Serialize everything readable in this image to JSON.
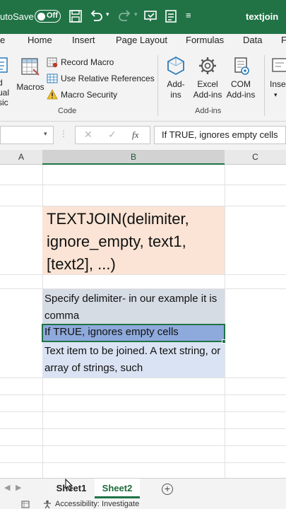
{
  "titlebar": {
    "autosave_label": "utoSave",
    "toggle_state": "Off",
    "file_title": "textjoin"
  },
  "tabs": [
    "e",
    "Home",
    "Insert",
    "Page Layout",
    "Formulas",
    "Data",
    "F"
  ],
  "ribbon": {
    "left_partial_lines": [
      "d",
      "ual",
      "sic"
    ],
    "macros_label": "Macros",
    "code_items": [
      "Record Macro",
      "Use Relative References",
      "Macro Security"
    ],
    "code_group": "Code",
    "addins": [
      {
        "line1": "Add-",
        "line2": "ins"
      },
      {
        "line1": "Excel",
        "line2": "Add-ins"
      },
      {
        "line1": "COM",
        "line2": "Add-ins"
      }
    ],
    "addins_group": "Add-ins",
    "insert_partial": "Inse"
  },
  "formula_bar": {
    "fx": "fx",
    "value": "If TRUE, ignores empty cells"
  },
  "columns": [
    "A",
    "B",
    "C"
  ],
  "cells": {
    "title": "TEXTJOIN(delimiter, ignore_empty, text1, [text2], ...)",
    "desc1": "Specify delimiter- in our example it is comma",
    "desc2": "If TRUE, ignores empty cells",
    "desc3": "Text item to be joined. A text string, or array of strings, such"
  },
  "sheets": [
    "Sheet1",
    "Sheet2"
  ],
  "add_sheet": "+",
  "status": {
    "accessibility": "Accessibility: Investigate"
  },
  "colors": {
    "brand": "#217346",
    "title_fill": "#fbe4d5",
    "desc1_fill": "#d6dce4",
    "desc2_fill": "#8ea9db",
    "desc3_fill": "#dae3f3"
  }
}
